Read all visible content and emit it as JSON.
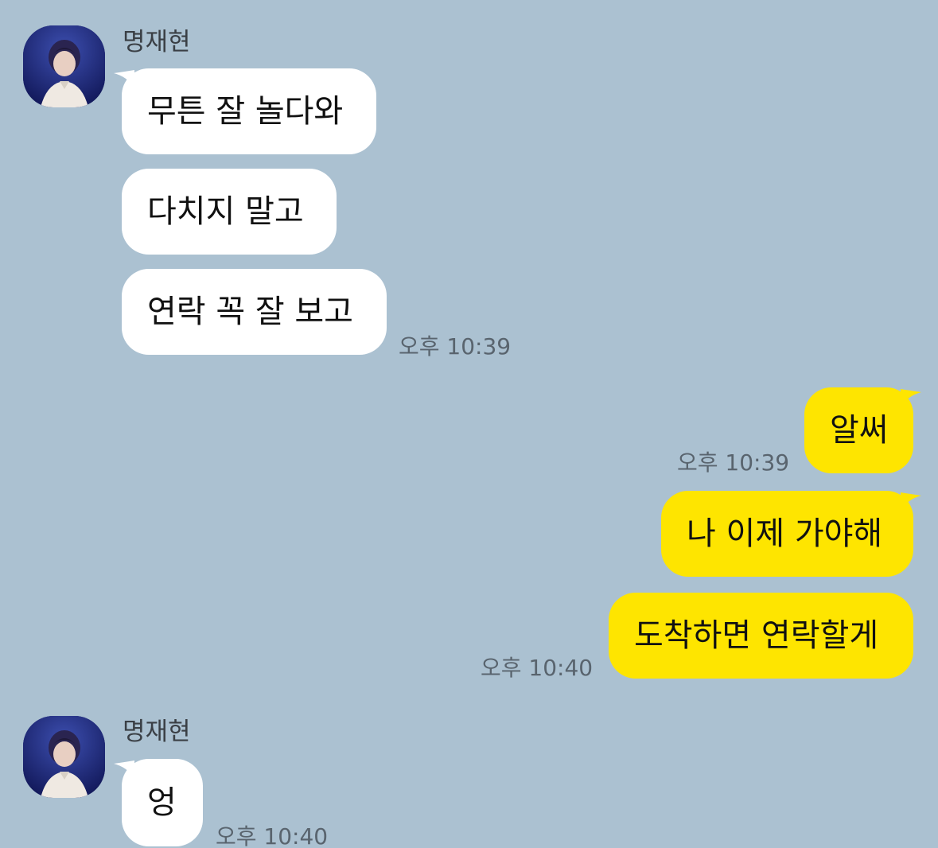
{
  "colors": {
    "background": "#abc1d1",
    "incoming_bubble": "#ffffff",
    "outgoing_bubble": "#fee500",
    "timestamp": "#59646e"
  },
  "groups": [
    {
      "sender": "명재현",
      "avatar_icon": "profile-photo",
      "messages": [
        "무튼 잘 놀다와",
        "다치지 말고",
        "연락 꼭 잘 보고"
      ],
      "time": "오후 10:39"
    },
    {
      "messages": [
        "알써"
      ],
      "time": "오후 10:39"
    },
    {
      "messages": [
        "나 이제 가야해",
        "도착하면 연락할게"
      ],
      "time": "오후 10:40"
    },
    {
      "sender": "명재현",
      "avatar_icon": "profile-photo",
      "messages": [
        "엉"
      ],
      "time": "오후 10:40"
    }
  ]
}
